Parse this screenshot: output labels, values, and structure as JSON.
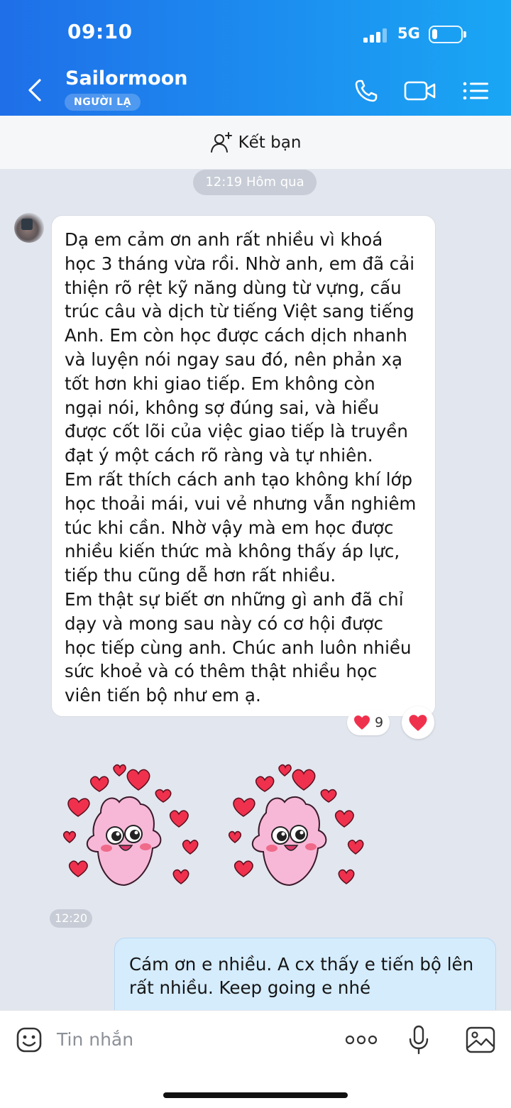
{
  "status_bar": {
    "time": "09:10",
    "network": "5G"
  },
  "header": {
    "contact_name": "Sailormoon",
    "badge": "NGƯỜI LẠ"
  },
  "add_friend": {
    "label": "Kết bạn"
  },
  "chat": {
    "time_separator": "12:19 Hôm qua",
    "incoming_message": "Dạ em cảm ơn anh rất nhiều vì khoá\nhọc 3 tháng vừa rồi. Nhờ anh, em đã cải\nthiện rõ rệt kỹ năng dùng từ vựng, cấu\ntrúc câu và dịch từ tiếng Việt sang tiếng\nAnh. Em còn học được cách dịch nhanh\nvà luyện nói ngay sau đó, nên phản xạ\ntốt hơn khi giao tiếp. Em không còn\nngại nói, không sợ đúng sai, và hiểu\nđược cốt lõi của việc giao tiếp là truyền\nđạt ý một cách rõ ràng và tự nhiên.\nEm rất thích cách anh tạo không khí lớp\nhọc thoải mái, vui vẻ nhưng vẫn nghiêm\ntúc khi cần. Nhờ vậy mà em học được\nnhiều kiến thức mà không thấy áp lực,\ntiếp thu cũng dễ hơn rất nhiều.\nEm thật sự biết ơn những gì anh đã chỉ\ndạy và mong sau này có cơ hội được\nhọc tiếp cùng anh. Chúc anh luôn nhiều\nsức khoẻ và có thêm thật nhiều học\nviên tiến bộ như em ạ.",
    "reaction_count": "9",
    "sticker_time": "12:20",
    "outgoing_message": "Cám ơn e nhiều. A cx thấy e tiến bộ lên\nrất nhiều. Keep going e nhé"
  },
  "composer": {
    "placeholder": "Tin nhắn"
  },
  "colors": {
    "header_blue": "#1f6fe8",
    "outgoing_bubble": "#d5ecfd",
    "heart_red": "#f0314d"
  },
  "icons": [
    "back-icon",
    "phone-icon",
    "video-icon",
    "menu-icon",
    "add-friend-icon",
    "heart-icon",
    "sticker-icon",
    "more-icon",
    "mic-icon",
    "image-icon"
  ]
}
